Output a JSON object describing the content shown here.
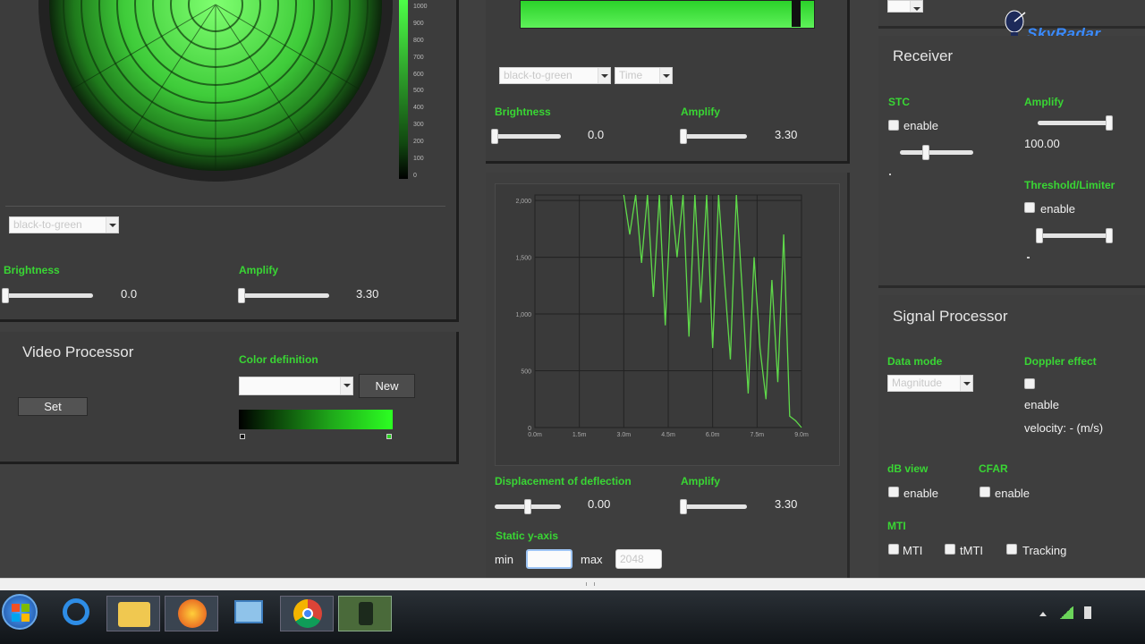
{
  "logo": {
    "text": "SkyRadar"
  },
  "ppi_panel": {
    "palette_select": "black-to-green",
    "brightness_label": "Brightness",
    "brightness_value": "0.0",
    "amplify_label": "Amplify",
    "amplify_value": "3.30",
    "brightness_level": 0.0,
    "amplify_level": 0.0,
    "colorbar_ticks": [
      "1000",
      "900",
      "800",
      "700",
      "600",
      "500",
      "400",
      "300",
      "200",
      "100",
      "0"
    ]
  },
  "video_processor": {
    "title": "Video Processor",
    "set_button": "Set",
    "color_definition_label": "Color definition",
    "new_button": "New"
  },
  "top_center": {
    "palette_select": "black-to-green",
    "mode_select": "Time",
    "brightness_label": "Brightness",
    "brightness_value": "0.0",
    "amplify_label": "Amplify",
    "amplify_value": "3.30"
  },
  "bottom_center": {
    "displacement_label": "Displacement of deflection",
    "displacement_value": "0.00",
    "amplify_label": "Amplify",
    "amplify_value": "3.30",
    "static_y_label": "Static y-axis",
    "min_label": "min",
    "max_label": "max",
    "max_value": "2048"
  },
  "receiver": {
    "title": "Receiver",
    "stc_label": "STC",
    "stc_enable": "enable",
    "amplify_label": "Amplify",
    "amplify_value": "100.00",
    "threshold_label": "Threshold/Limiter",
    "threshold_enable": "enable"
  },
  "signal_processor": {
    "title": "Signal Processor",
    "data_mode_label": "Data mode",
    "data_mode_value": "Magnitude",
    "doppler_label": "Doppler effect",
    "doppler_enable": "enable",
    "velocity_text": "velocity: - (m/s)",
    "db_view_label": "dB view",
    "db_view_enable": "enable",
    "cfar_label": "CFAR",
    "cfar_enable": "enable",
    "mti_label": "MTI",
    "mti_option": "MTI",
    "tmti_option": "tMTI",
    "tracking_option": "Tracking"
  },
  "chart_data": {
    "type": "line",
    "y_ticks": [
      "2,000",
      "1,500",
      "1,000",
      "500",
      "0"
    ],
    "x_ticks": [
      "0.0m",
      "1.5m",
      "3.0m",
      "4.5m",
      "6.0m",
      "7.5m",
      "9.0m"
    ],
    "ylim": [
      0,
      2048
    ],
    "xlim": [
      0,
      9
    ],
    "x": [
      0.0,
      1.5,
      3.0,
      3.2,
      3.4,
      3.6,
      3.8,
      4.0,
      4.2,
      4.4,
      4.6,
      4.8,
      5.0,
      5.2,
      5.4,
      5.6,
      5.8,
      6.0,
      6.2,
      6.4,
      6.6,
      6.8,
      7.0,
      7.2,
      7.4,
      7.6,
      7.8,
      8.0,
      8.2,
      8.4,
      8.6,
      8.8,
      9.0
    ],
    "y": [
      null,
      null,
      2048,
      1700,
      2048,
      1450,
      2048,
      1150,
      2048,
      900,
      2048,
      1500,
      2048,
      800,
      2048,
      1100,
      2048,
      700,
      2048,
      1300,
      600,
      2048,
      1200,
      300,
      1500,
      700,
      250,
      1300,
      400,
      1700,
      100,
      60,
      0
    ],
    "grid": true,
    "line_color": "#5fd94a"
  },
  "colors": {
    "accent_green": "#39d634",
    "panel": "#3c3c3c",
    "background": "#404040"
  }
}
